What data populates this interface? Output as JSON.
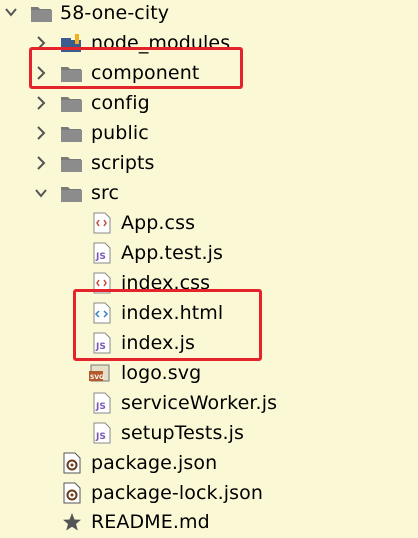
{
  "tree": {
    "root": {
      "label": "58-one-city",
      "icon": "folder-icon",
      "state": "expanded"
    },
    "items": [
      {
        "label": "node_modules",
        "icon": "library-folder-icon",
        "state": "collapsed"
      },
      {
        "label": "component",
        "icon": "folder-icon",
        "state": "collapsed",
        "highlighted": true
      },
      {
        "label": "config",
        "icon": "folder-icon",
        "state": "collapsed"
      },
      {
        "label": "public",
        "icon": "folder-icon",
        "state": "collapsed"
      },
      {
        "label": "scripts",
        "icon": "folder-icon",
        "state": "collapsed"
      },
      {
        "label": "src",
        "icon": "folder-icon",
        "state": "expanded"
      },
      {
        "label": "App.css",
        "icon": "css-file-icon"
      },
      {
        "label": "App.test.js",
        "icon": "js-file-icon"
      },
      {
        "label": "index.css",
        "icon": "css-file-icon"
      },
      {
        "label": "index.html",
        "icon": "html-file-icon",
        "highlighted": true
      },
      {
        "label": "index.js",
        "icon": "js-file-icon",
        "highlighted": true
      },
      {
        "label": "logo.svg",
        "icon": "svg-file-icon"
      },
      {
        "label": "serviceWorker.js",
        "icon": "js-file-icon"
      },
      {
        "label": "setupTests.js",
        "icon": "js-file-icon"
      },
      {
        "label": "package.json",
        "icon": "json-file-icon"
      },
      {
        "label": "package-lock.json",
        "icon": "json-file-icon"
      },
      {
        "label": "README.md",
        "icon": "markdown-star-icon"
      }
    ]
  },
  "colors": {
    "background": "#fbf8d5",
    "highlight_border": "#e5232b",
    "folder": "#6f6f6f",
    "js_badge": "#7a59b5",
    "css_badge": "#c34a3a",
    "html_badge": "#2f87c8"
  }
}
